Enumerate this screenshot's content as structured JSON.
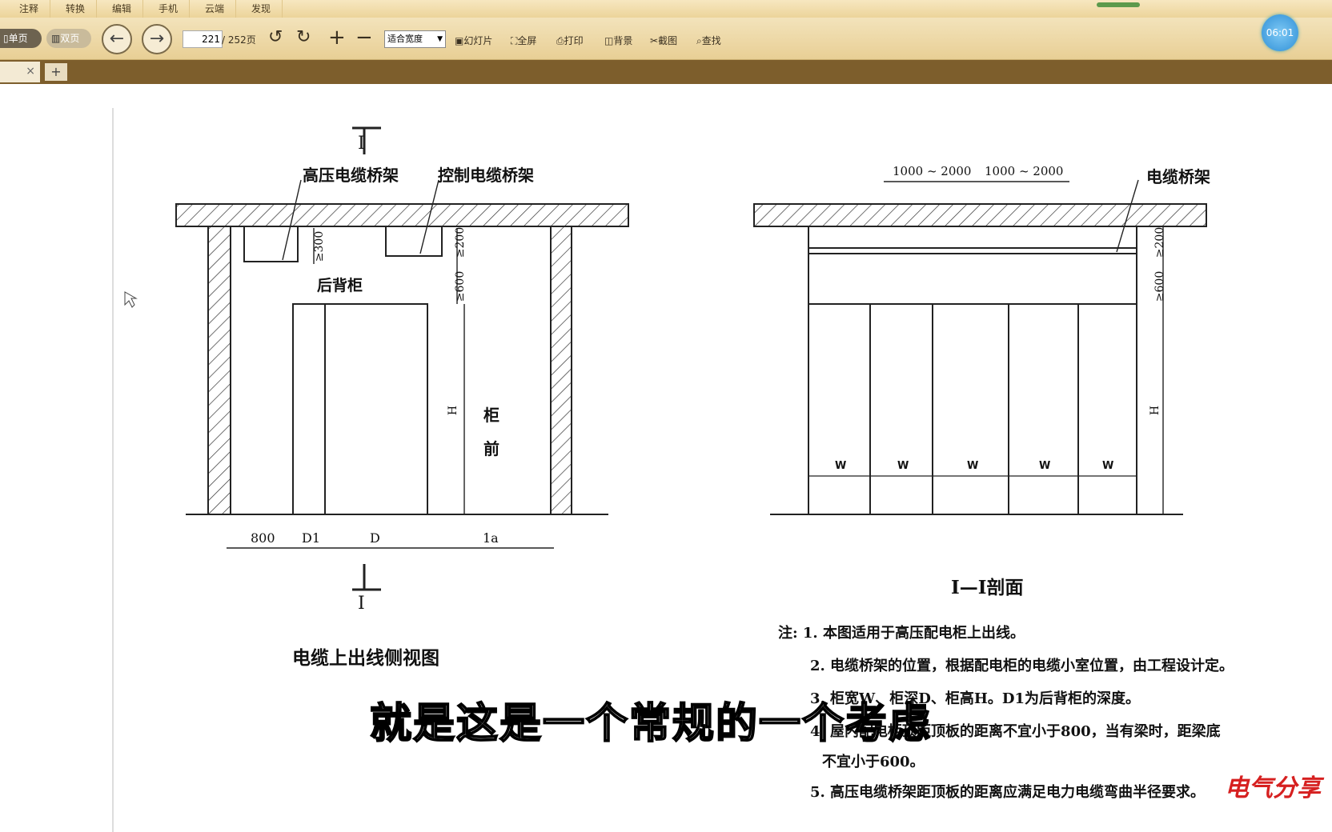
{
  "menu": [
    "注释",
    "转换",
    "编辑",
    "手机",
    "云端",
    "发现"
  ],
  "toolbar": {
    "single_page": "单页",
    "double_page": "双页",
    "page_input": "221",
    "page_total": "/ 252页",
    "zoom_value": "适合宽度",
    "slideshow": "幻灯片",
    "fullscreen": "全屏",
    "print": "打印",
    "background": "背景",
    "screenshot": "截图",
    "find": "查找"
  },
  "clock": "06:01",
  "tab_close": "×",
  "tab_add": "+",
  "drawing": {
    "hv_tray": "高压电缆桥架",
    "ctrl_tray": "控制电缆桥架",
    "rear_cab": "后背柜",
    "front1": "柜",
    "front2": "前",
    "dim_300": "≥300",
    "dim_200": "≥200",
    "dim_600": "≥600",
    "h_label": "H",
    "d800": "800",
    "d1": "D1",
    "d": "D",
    "la": "1a",
    "sec_mark": "I",
    "left_title": "电缆上出线侧视图",
    "span1": "1000 ~ 2000",
    "span2": "1000 ~ 2000",
    "tray": "电缆桥架",
    "w": "W",
    "right_title": "I—I剖面"
  },
  "notes": [
    "注: 1. 本图适用于高压配电柜上出线。",
    "2. 电缆桥架的位置，根据配电柜的电缆小室位置，由工程设计定。",
    "3. 柜宽W、柜深D、柜高H。D1为后背柜的深度。",
    "4. 屋内配电柜顶距顶板的距离不宜小于800，当有梁时，距梁底",
    "不宜小于600。",
    "5. 高压电缆桥架距顶板的距离应满足电力电缆弯曲半径要求。"
  ],
  "subtitle": "就是这是一个常规的一个考虑",
  "watermark": "电气分享"
}
